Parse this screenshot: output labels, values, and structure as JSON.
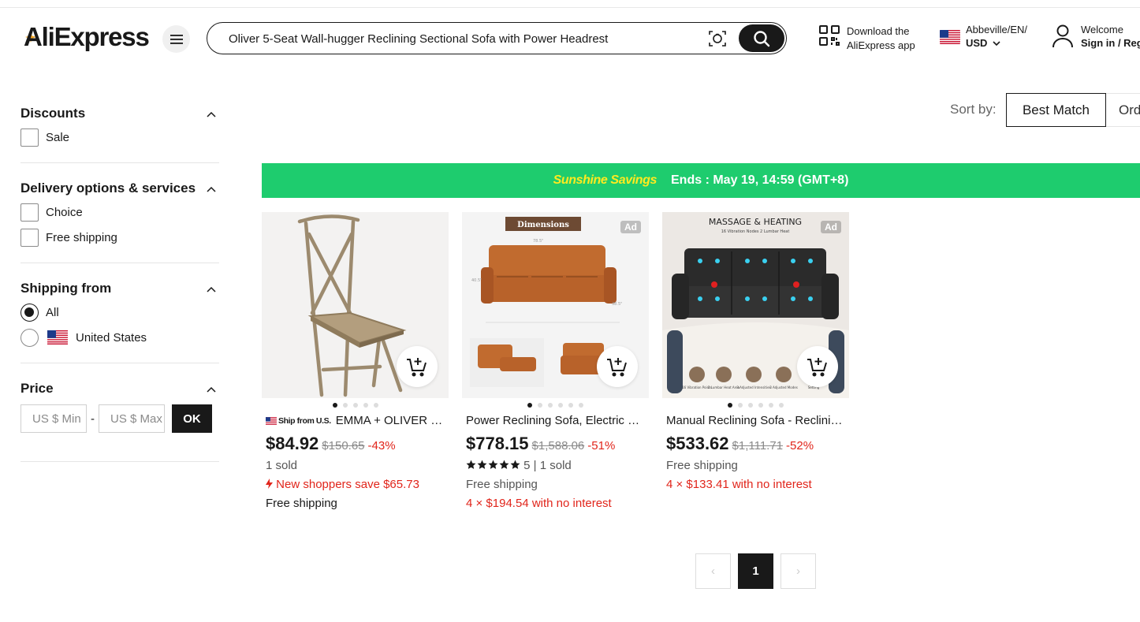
{
  "header": {
    "logo_text": "AliExpress",
    "search_value": "Oliver 5-Seat Wall-hugger Reclining Sectional Sofa with Power Headrest",
    "app_line1": "Download the",
    "app_line2": "AliExpress app",
    "locale_line1": "Abbeville/EN/",
    "locale_currency": "USD",
    "account_line1": "Welcome",
    "account_line2": "Sign in / Register"
  },
  "filters": {
    "discounts": {
      "title": "Discounts",
      "options": [
        "Sale"
      ]
    },
    "delivery": {
      "title": "Delivery options & services",
      "options": [
        "Choice",
        "Free shipping"
      ]
    },
    "shipping_from": {
      "title": "Shipping from",
      "options": [
        "All",
        "United States"
      ],
      "selected": "All"
    },
    "price": {
      "title": "Price",
      "min_placeholder": "US $ Min",
      "max_placeholder": "US $ Max",
      "dash": "-",
      "ok_label": "OK"
    }
  },
  "sort": {
    "label": "Sort by:",
    "options": [
      "Best Match",
      "Orders"
    ],
    "active": "Best Match"
  },
  "banner": {
    "name": "Sunshine Savings",
    "ends": "Ends :  May 19, 14:59 (GMT+8)"
  },
  "products": [
    {
      "badge": "Ship from U.S.",
      "title": "EMMA + OLIVER Rustic Farmhouse Chair",
      "price": "$84.92",
      "original": "$150.65",
      "discount": "-43%",
      "sold": "1 sold",
      "promo": "New shoppers save $65.73",
      "shipping": "Free shipping"
    },
    {
      "ad": "Ad",
      "image_caption": "Dimensions",
      "title": "Power Reclining Sofa, Electric Recliner",
      "price": "$778.15",
      "original": "$1,588.06",
      "discount": "-51%",
      "rating": "5",
      "sold": "1 sold",
      "shipping": "Free shipping",
      "installment": "4 × $194.54 with no interest"
    },
    {
      "ad": "Ad",
      "image_caption": "MASSAGE & HEATING",
      "image_subcaption": "16 Vibration Nodes   2 Lumbar Heat",
      "image_features": [
        "16 Vibration Points",
        "2 Lumbar Heat Area",
        "3 Adjusted Intensities",
        "3 Adjusted Modes",
        "Setting"
      ],
      "title": "Manual Reclining Sofa - Reclining Loveseat",
      "price": "$533.62",
      "original": "$1,111.71",
      "discount": "-52%",
      "shipping": "Free shipping",
      "installment": "4 × $133.41 with no interest"
    }
  ],
  "pagination": {
    "prev": "‹",
    "current": "1",
    "next": "›"
  },
  "colors": {
    "banner": "#1ecc6e",
    "banner_name": "#ffea1f",
    "discount": "#e1251b",
    "dark": "#191919"
  }
}
